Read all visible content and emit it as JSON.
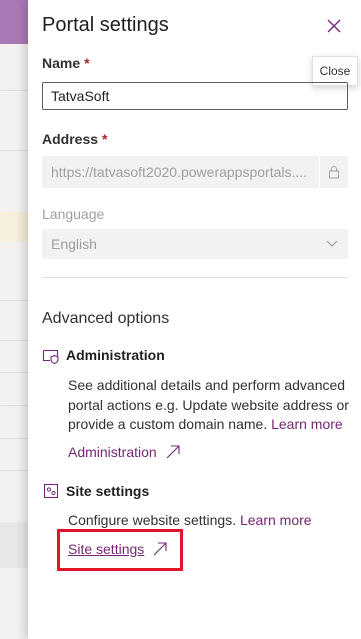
{
  "panel": {
    "title": "Portal settings",
    "close_tooltip": "Close"
  },
  "fields": {
    "name": {
      "label": "Name",
      "required_mark": "*",
      "value": "TatvaSoft"
    },
    "address": {
      "label": "Address",
      "required_mark": "*",
      "value": "https://tatvasoft2020.powerappsportals...."
    },
    "language": {
      "label": "Language",
      "value": "English"
    }
  },
  "advanced": {
    "title": "Advanced options",
    "administration": {
      "icon": "admin-shield-icon",
      "heading": "Administration",
      "description": "See additional details and perform advanced portal actions e.g. Update website address or provide a custom domain name.",
      "learn_more": "Learn more",
      "link_label": "Administration"
    },
    "site_settings": {
      "icon": "site-settings-icon",
      "heading": "Site settings",
      "description": "Configure website settings.",
      "learn_more": "Learn more",
      "link_label": "Site settings"
    }
  },
  "colors": {
    "accent": "#742774",
    "highlight": "#e0152a",
    "required": "#a4262c"
  }
}
